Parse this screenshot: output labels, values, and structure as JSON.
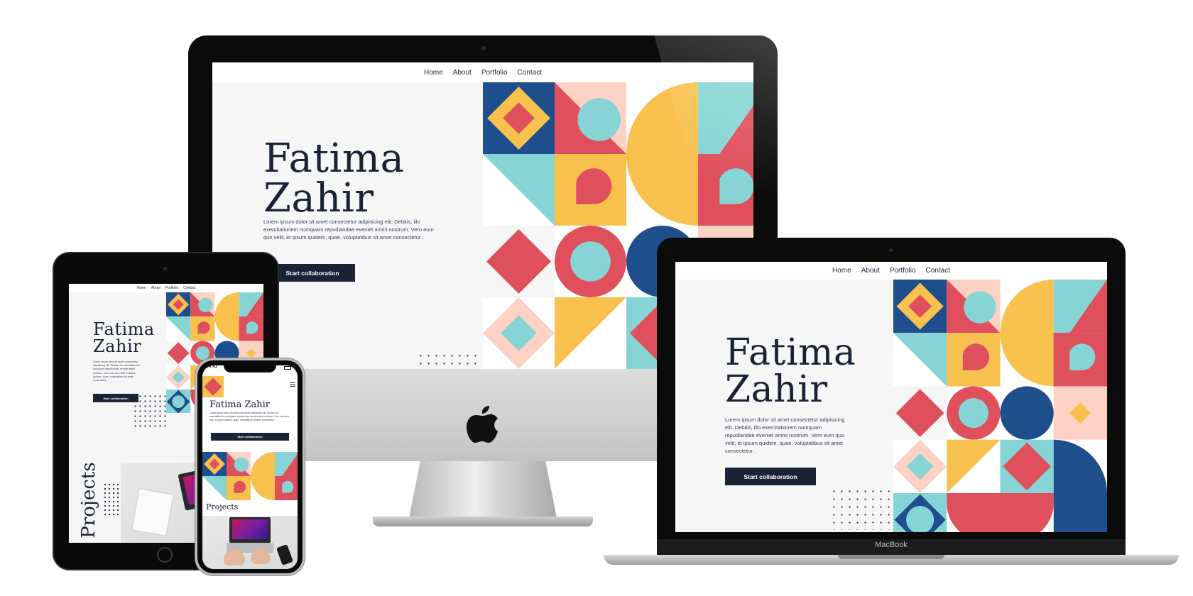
{
  "site": {
    "nav": [
      {
        "label": "Home"
      },
      {
        "label": "About"
      },
      {
        "label": "Portfolio"
      },
      {
        "label": "Contact"
      }
    ],
    "first_name": "Fatima",
    "last_name": "Zahir",
    "full_name": "Fatima Zahir",
    "description": "Lorem ipsum dolor sit amet consectetur adipisicing elit. Debitis, illo exercitationem numquam repudiandae eveniet animi nostrum. Vero eum quo velit, et ipsum quidem, quae, voluptatibus sit amet consectetur .",
    "cta_label": "Start collaboration",
    "projects_heading": "Projects"
  },
  "macbook": {
    "brand_label": "MacBook"
  },
  "iphone": {
    "time": "9:41"
  },
  "colors": {
    "navy": "#1e4e8c",
    "red": "#e0505c",
    "yellow": "#f8c14e",
    "teal": "#86d4d5",
    "peach": "#fdd2c4",
    "dark": "#1b2236",
    "background": "#f6f6f7"
  },
  "icons": [
    "apple-logo-icon",
    "hamburger-menu-icon",
    "camera-icon",
    "home-button-icon"
  ]
}
